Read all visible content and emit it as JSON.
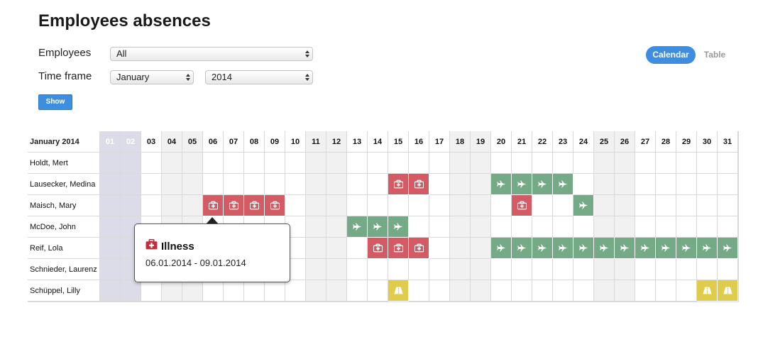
{
  "page": {
    "title": "Employees absences"
  },
  "filters": {
    "employees_label": "Employees",
    "employees_value": "All",
    "timeframe_label": "Time frame",
    "month_value": "January",
    "year_value": "2014",
    "show_label": "Show"
  },
  "view_toggle": {
    "calendar_label": "Calendar",
    "table_label": "Table"
  },
  "calendar": {
    "month_label": "January 2014",
    "days": [
      "01",
      "02",
      "03",
      "04",
      "05",
      "06",
      "07",
      "08",
      "09",
      "10",
      "11",
      "12",
      "13",
      "14",
      "15",
      "16",
      "17",
      "18",
      "19",
      "20",
      "21",
      "22",
      "23",
      "24",
      "25",
      "26",
      "27",
      "28",
      "29",
      "30",
      "31"
    ],
    "highlighted_days": [
      1,
      2
    ],
    "weekend_days": [
      4,
      5,
      11,
      12,
      18,
      19,
      25,
      26
    ],
    "employees": [
      {
        "name": "Holdt, Mert",
        "absences": []
      },
      {
        "name": "Lausecker, Medina",
        "absences": [
          {
            "type": "illness",
            "days": [
              15,
              16
            ]
          },
          {
            "type": "vacation",
            "days": [
              20,
              21,
              22,
              23
            ]
          }
        ]
      },
      {
        "name": "Maisch, Mary",
        "absences": [
          {
            "type": "illness",
            "days": [
              6,
              7,
              8,
              9
            ]
          },
          {
            "type": "illness",
            "days": [
              21
            ]
          },
          {
            "type": "vacation",
            "days": [
              24
            ]
          }
        ]
      },
      {
        "name": "McDoe, John",
        "absences": [
          {
            "type": "vacation",
            "days": [
              13,
              14,
              15
            ]
          }
        ]
      },
      {
        "name": "Reif, Lola",
        "absences": [
          {
            "type": "illness",
            "days": [
              14,
              15,
              16
            ]
          },
          {
            "type": "vacation",
            "days": [
              20,
              21,
              22,
              23,
              24,
              25,
              26,
              27,
              28,
              29,
              30,
              31
            ]
          }
        ]
      },
      {
        "name": "Schnieder, Laurenz",
        "absences": []
      },
      {
        "name": "Schüppel, Lilly",
        "absences": [
          {
            "type": "other",
            "days": [
              15
            ]
          },
          {
            "type": "other",
            "days": [
              30,
              31
            ]
          }
        ]
      }
    ]
  },
  "absence_types": {
    "illness": {
      "color": "#d45b63",
      "icon": "first-aid-kit-icon"
    },
    "vacation": {
      "color": "#74ab86",
      "icon": "airplane-icon"
    },
    "other": {
      "color": "#e0cb4a",
      "icon": "road-icon"
    }
  },
  "colors": {
    "accent": "#3d8de0",
    "highlight_day": "#dcdce8",
    "highlight_day_text": "#ffffff",
    "weekend": "#f1f1f1",
    "workday": "#ffffff"
  },
  "tooltip": {
    "title": "Illness",
    "icon": "first-aid-kit-icon",
    "range": "06.01.2014 - 09.01.2014"
  }
}
